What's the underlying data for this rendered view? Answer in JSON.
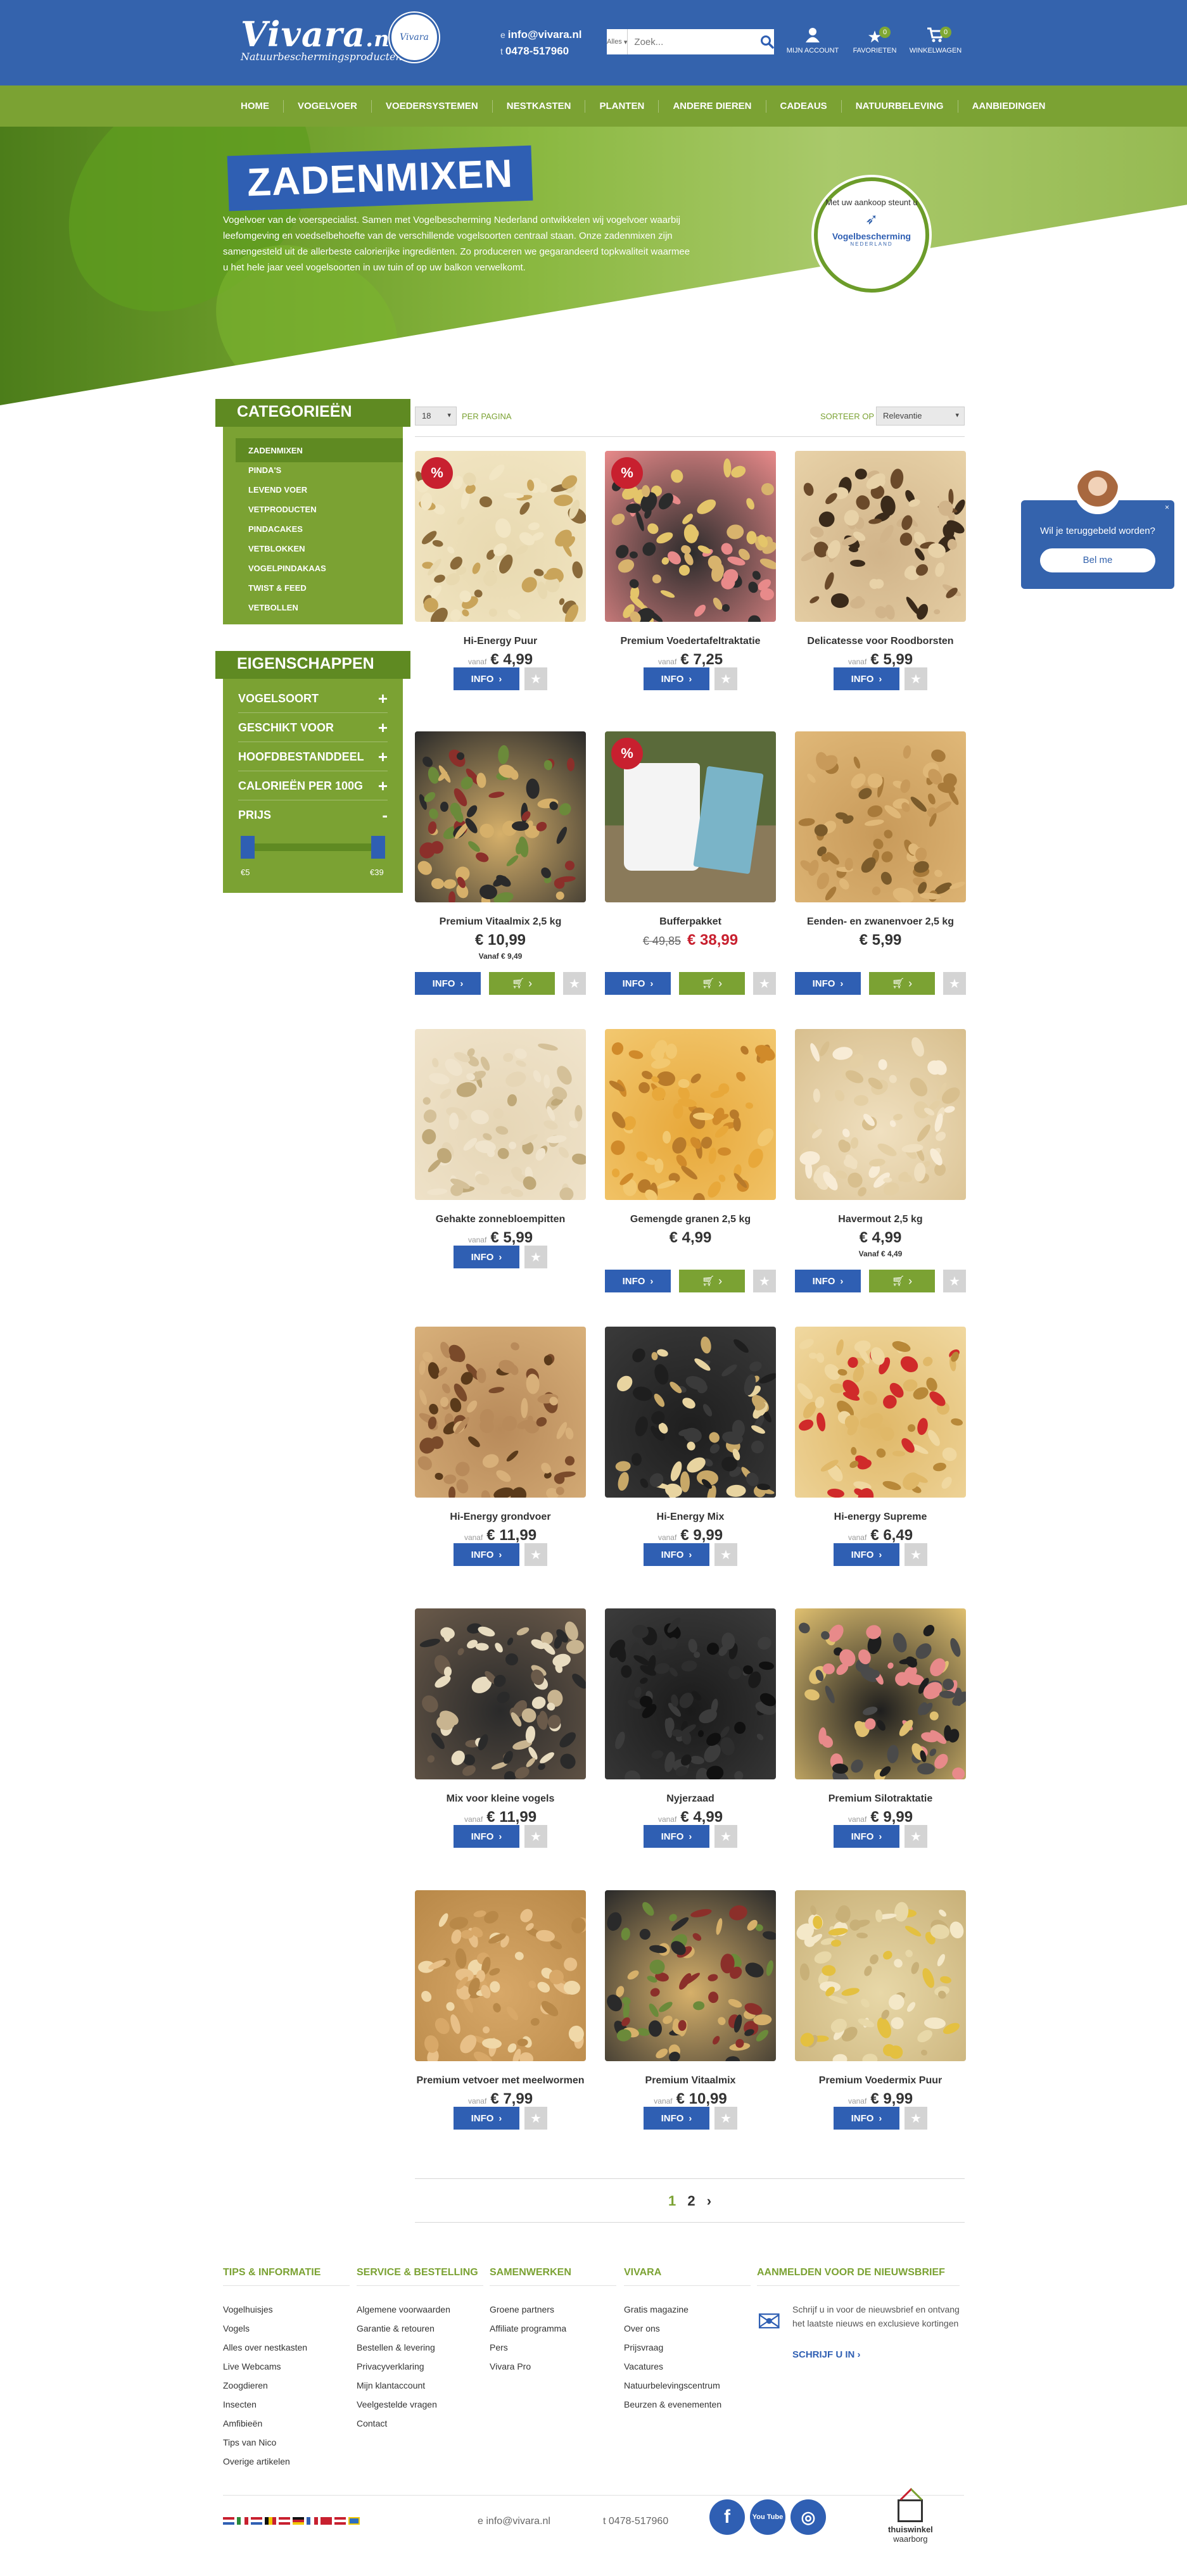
{
  "header": {
    "logo": "Vivara",
    "logo_suffix": ".nl",
    "logo_sub": "Natuurbeschermingsproducten",
    "badge": "Vivara",
    "email_prefix": "e",
    "email": "info@vivara.nl",
    "phone_prefix": "t",
    "phone": "0478-517960",
    "search_scope": "Alles",
    "search_placeholder": "Zoek...",
    "account": "MIJN ACCOUNT",
    "favorites": "FAVORIETEN",
    "favorites_count": "0",
    "cart": "WINKELWAGEN",
    "cart_count": "0"
  },
  "nav": [
    "HOME",
    "VOGELVOER",
    "VOEDERSYSTEMEN",
    "NESTKASTEN",
    "PLANTEN",
    "ANDERE DIEREN",
    "CADEAUS",
    "NATUURBELEVING",
    "AANBIEDINGEN"
  ],
  "hero": {
    "title": "ZADENMIXEN",
    "text": "Vogelvoer van de voerspecialist. Samen met Vogelbescherming Nederland ontwikkelen wij vogelvoer waarbij leefomgeving en voedselbehoefte van de verschillende vogelsoorten centraal staan. Onze zadenmixen zijn samengesteld uit de allerbeste calorierijke ingrediënten. Zo produceren we gegarandeerd topkwaliteit waarmee u het hele jaar veel vogelsoorten in uw tuin of op uw balkon verwelkomt.",
    "seal_top": "Met uw aankoop steunt u",
    "seal_org": "Vogelbescherming",
    "seal_sub": "NEDERLAND"
  },
  "sidebar": {
    "categories_title": "CATEGORIEËN",
    "categories": [
      "ZADENMIXEN",
      "PINDA'S",
      "LEVEND VOER",
      "VETPRODUCTEN",
      "PINDACAKES",
      "VETBLOKKEN",
      "VOGELPINDAKAAS",
      "TWIST & FEED",
      "VETBOLLEN"
    ],
    "properties_title": "EIGENSCHAPPEN",
    "properties": [
      "VOGELSOORT",
      "GESCHIKT VOOR",
      "HOOFDBESTANDDEEL",
      "CALORIEËN PER 100G",
      "PRIJS"
    ],
    "plus": "+",
    "minus": "-",
    "price_min": "€5",
    "price_max": "€39"
  },
  "toolbar": {
    "per_page_value": "18",
    "per_page_label": "PER PAGINA",
    "sort_label": "SORTEER OP",
    "sort_value": "Relevantie"
  },
  "labels": {
    "info": "INFO",
    "vanaf": "vanaf",
    "sale_badge": "%"
  },
  "products": [
    {
      "name": "Hi-Energy Puur",
      "vanaf": "vanaf",
      "price": "€ 4,99",
      "sale": true,
      "colors": [
        "#e8d9b0",
        "#c9a45a",
        "#f2e6c4",
        "#8a6a3a"
      ]
    },
    {
      "name": "Premium Voedertafeltraktatie",
      "vanaf": "vanaf",
      "price": "€ 7,25",
      "sale": true,
      "colors": [
        "#2b2b2b",
        "#e4c56a",
        "#e88a8a",
        "#d8b36d"
      ]
    },
    {
      "name": "Delicatesse voor Roodborsten",
      "vanaf": "vanaf",
      "price": "€ 5,99",
      "sale": false,
      "colors": [
        "#d1b48a",
        "#6b4a2a",
        "#e8d2a8",
        "#3a2a1a"
      ]
    },
    {
      "name": "Premium Vitaalmix 2,5 kg",
      "price": "€ 10,99",
      "sub": "Vanaf € 9,49",
      "sale": false,
      "cart": true,
      "colors": [
        "#d6b06a",
        "#8b2f2a",
        "#2a2a2a",
        "#6b8a3a"
      ]
    },
    {
      "name": "Bufferpakket",
      "old_price": "€ 49,85",
      "price": "€ 38,99",
      "sale": true,
      "cart": true,
      "bucket": true
    },
    {
      "name": "Eenden- en zwanenvoer 2,5 kg",
      "price": "€ 5,99",
      "sale": false,
      "cart": true,
      "colors": [
        "#c89a5a",
        "#a87a3a",
        "#e0b878",
        "#7a5a2a"
      ]
    },
    {
      "name": "Gehakte zonnebloempitten",
      "vanaf": "vanaf",
      "price": "€ 5,99",
      "sale": false,
      "colors": [
        "#e6d6b6",
        "#d4c098",
        "#f0e4cc",
        "#bfa878"
      ]
    },
    {
      "name": "Gemengde granen 2,5 kg",
      "price": "€ 4,99",
      "sale": false,
      "cart": true,
      "colors": [
        "#e8a83a",
        "#d08a2a",
        "#f2c870",
        "#b87a2a"
      ]
    },
    {
      "name": "Havermout 2,5 kg",
      "price": "€ 4,99",
      "sub": "Vanaf € 4,49",
      "sale": false,
      "cart": true,
      "colors": [
        "#f0e0c0",
        "#e4cfa4",
        "#d8bf8e",
        "#f8ecd6"
      ]
    },
    {
      "name": "Hi-Energy grondvoer",
      "vanaf": "vanaf",
      "price": "€ 11,99",
      "sale": false,
      "colors": [
        "#b88a5a",
        "#7a4a2a",
        "#d8b07a",
        "#5a3a1a"
      ]
    },
    {
      "name": "Hi-Energy Mix",
      "vanaf": "vanaf",
      "price": "€ 9,99",
      "sale": false,
      "colors": [
        "#1e1e1e",
        "#e8d4a0",
        "#3a3a3a",
        "#c8a868"
      ]
    },
    {
      "name": "Hi-energy Supreme",
      "vanaf": "vanaf",
      "price": "€ 6,49",
      "sale": false,
      "colors": [
        "#e0b868",
        "#d02a2a",
        "#f0d8a0",
        "#b88838"
      ]
    },
    {
      "name": "Mix voor kleine vogels",
      "vanaf": "vanaf",
      "price": "€ 11,99",
      "sale": false,
      "colors": [
        "#2a2a2a",
        "#e8dcc0",
        "#6a5a4a",
        "#c8b490"
      ]
    },
    {
      "name": "Nyjerzaad",
      "vanaf": "vanaf",
      "price": "€ 4,99",
      "sale": false,
      "colors": [
        "#1a1a1a",
        "#2e2e2e",
        "#3c3c3c",
        "#101010"
      ]
    },
    {
      "name": "Premium Silotraktatie",
      "vanaf": "vanaf",
      "price": "€ 9,99",
      "sale": false,
      "colors": [
        "#1e1e1e",
        "#e88a8a",
        "#e0c070",
        "#4a4a4a"
      ]
    },
    {
      "name": "Premium vetvoer met meelwormen",
      "vanaf": "vanaf",
      "price": "€ 7,99",
      "sale": false,
      "colors": [
        "#d8a868",
        "#f0d8a8",
        "#b88848",
        "#e8c088"
      ]
    },
    {
      "name": "Premium Vitaalmix",
      "vanaf": "vanaf",
      "price": "€ 10,99",
      "sale": false,
      "colors": [
        "#d6b06a",
        "#8b2f2a",
        "#2a2a2a",
        "#6b8a3a"
      ]
    },
    {
      "name": "Premium Voedermix Puur",
      "vanaf": "vanaf",
      "price": "€ 9,99",
      "sale": false,
      "colors": [
        "#e8d8a8",
        "#e4c040",
        "#c8b078",
        "#f4e8c8"
      ]
    }
  ],
  "pagination": {
    "current": "1",
    "next": "2",
    "arrow": "›"
  },
  "footer": {
    "columns": [
      {
        "title": "TIPS & INFORMATIE",
        "items": [
          "Vogelhuisjes",
          "Vogels",
          "Alles over nestkasten",
          "Live Webcams",
          "Zoogdieren",
          "Insecten",
          "Amfibieën",
          "Tips van Nico",
          "Overige artikelen"
        ]
      },
      {
        "title": "SERVICE & BESTELLING",
        "items": [
          "Algemene voorwaarden",
          "Garantie & retouren",
          "Bestellen & levering",
          "Privacyverklaring",
          "Mijn klantaccount",
          "Veelgestelde vragen",
          "Contact"
        ]
      },
      {
        "title": "SAMENWERKEN",
        "items": [
          "Groene partners",
          "Affiliate programma",
          "Pers",
          "Vivara Pro"
        ]
      },
      {
        "title": "VIVARA",
        "items": [
          "Gratis magazine",
          "Over ons",
          "Prijsvraag",
          "Vacatures",
          "Natuurbelevingscentrum",
          "Beurzen & evenementen"
        ]
      }
    ],
    "newsletter_title": "AANMELDEN VOOR DE NIEUWSBRIEF",
    "newsletter_text": "Schrijf u in voor de nieuwsbrief en ontvang het laatste nieuws en exclusieve kortingen",
    "newsletter_link": "SCHRIJF U IN",
    "email_prefix": "e",
    "email": "info@vivara.nl",
    "phone_prefix": "t",
    "phone": "0478-517960",
    "social": [
      "f",
      "You Tube",
      "◎"
    ],
    "trust_line1": "thuiswinkel",
    "trust_line2": "waarborg"
  },
  "callback": {
    "question": "Wil je teruggebeld worden?",
    "button": "Bel me",
    "close": "×"
  }
}
